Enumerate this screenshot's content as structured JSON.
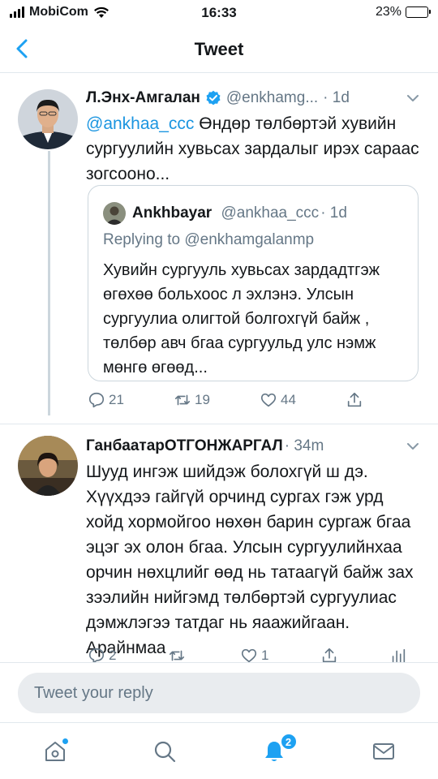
{
  "status_bar": {
    "carrier": "MobiCom",
    "time": "16:33",
    "battery": "23%",
    "battery_level": 0.23
  },
  "nav": {
    "title": "Tweet"
  },
  "tweets": [
    {
      "name": "Л.Энх-Амгалан",
      "handle": "@enkhamg...",
      "time": "· 1d",
      "mention": "@ankhaa_ccc",
      "text": " Өндөр төлбөртэй хувийн сургуулийн хувьсах зардалыг ирэх сараас зогсооно...",
      "quote": {
        "name": "Ankhbayar",
        "handle": "@ankhaa_ccc",
        "time": "· 1d",
        "replying": "Replying to @enkhamgalanmp",
        "text": "Хувийн сургууль хувьсах зардадтгэж өгөхөө больхоос л эхлэнэ. Улсын сургуулиа олигтой болгохгүй байж , төлбөр авч бгаа сургуульд улс нэмж мөнгө өгөөд..."
      },
      "actions": {
        "replies": "21",
        "retweets": "19",
        "likes": "44"
      }
    },
    {
      "name": "ГанбаатарОТГОНЖАРГАЛ",
      "handle": "",
      "time": "· 34m",
      "text": "Шууд ингэж шийдэж болохгүй ш дэ. Хүүхдээ гайгүй орчинд сургах гэж урд хойд хормойгоо нөхөн барин сургаж бгаа эцэг эх олон бгаа. Улсын сургуулийнхаа орчин нөхцлийг өөд нь татаагүй байж зах зээлийн нийгэмд төлбөртэй сургуулиас дэмжлэгээ татдаг нь яаажийгаан. Арайнмаа",
      "actions": {
        "replies": "2",
        "retweets": "",
        "likes": "1"
      }
    }
  ],
  "reply": {
    "placeholder": "Tweet your reply"
  },
  "tabs": {
    "notifications_badge": "2"
  },
  "colors": {
    "accent": "#1da1f2",
    "muted": "#657786",
    "border": "#e1e8ed"
  },
  "icons": [
    "back-arrow-icon",
    "verified-icon",
    "chevron-down-icon",
    "reply-icon",
    "retweet-icon",
    "like-icon",
    "share-icon",
    "analytics-icon",
    "home-icon",
    "search-icon",
    "notifications-icon",
    "messages-icon"
  ]
}
